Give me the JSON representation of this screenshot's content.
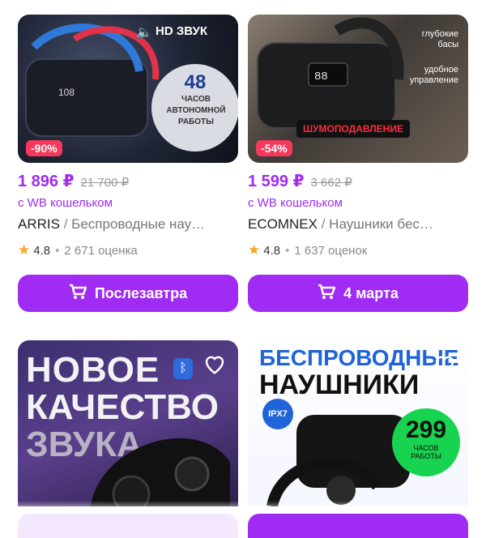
{
  "products": [
    {
      "image_text_1": "HD ЗВУК",
      "image_text_2": "48",
      "image_text_3": "ЧАСОВ АВТОНОМНОЙ РАБОТЫ",
      "discount": "-90%",
      "price": "1 896 ₽",
      "old_price": "21 700 ₽",
      "wallet_note": "с WB кошельком",
      "brand": "ARRIS",
      "separator": "/",
      "name": "Беспроводные нау…",
      "rating": "4.8",
      "reviews": "2 671 оценка",
      "button_label": "Послезавтра"
    },
    {
      "image_text_1": "глубокие басы",
      "image_text_2": "удобное управление",
      "image_text_3": "ШУМОПОДАВЛЕНИЕ",
      "discount": "-54%",
      "price": "1 599 ₽",
      "old_price": "3 662 ₽",
      "wallet_note": "с WB кошельком",
      "brand": "ECOMNEX",
      "separator": "/",
      "name": "Наушники бес…",
      "rating": "4.8",
      "reviews": "1 637 оценок",
      "button_label": "4 марта"
    },
    {
      "image_text_1": "НОВОЕ",
      "image_text_2": "КАЧЕСТВО",
      "image_text_3": "ЗВУКА"
    },
    {
      "image_text_1": "БЕСПРОВОДНЫЕ",
      "image_text_2": "НАУШНИКИ",
      "image_text_3": "299",
      "image_text_4": "ЧАСОВ РАБОТЫ",
      "image_text_5": "IPX7"
    }
  ],
  "colors": {
    "accent": "#a02bf2",
    "discount": "#f5385c",
    "star": "#f6a623"
  }
}
